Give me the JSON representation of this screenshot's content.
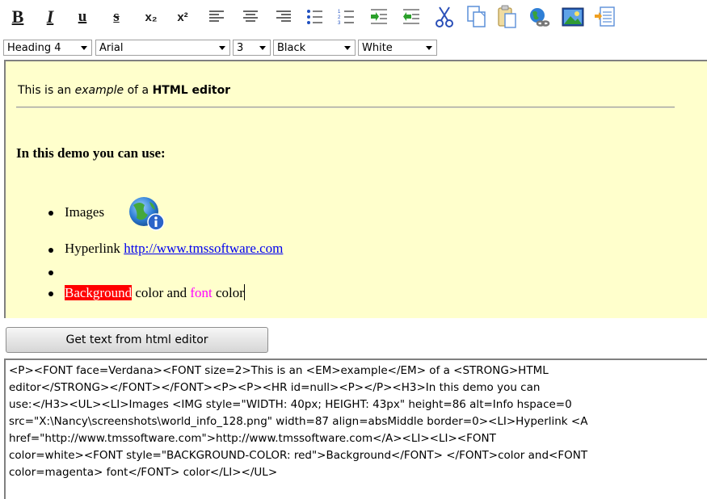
{
  "toolbar": {
    "bold": "B",
    "italic": "I",
    "underline": "u",
    "strikeout": "s",
    "subscript": "x₂",
    "superscript": "x²",
    "icons": [
      "align-left-icon",
      "align-center-icon",
      "align-right-icon",
      "bullet-list-icon",
      "numbered-list-icon",
      "indent-icon",
      "outdent-icon",
      "cut-icon",
      "copy-icon",
      "paste-icon",
      "hyperlink-icon",
      "insert-image-icon",
      "insert-text-icon"
    ]
  },
  "format": {
    "heading": "Heading 4",
    "font": "Arial",
    "size": "3",
    "font_color": "Black",
    "bg_color": "White"
  },
  "editor": {
    "line1": {
      "pre": "This is an ",
      "em": "example",
      "mid": " of a ",
      "strong": "HTML editor"
    },
    "heading": "In this demo you can use:",
    "items": {
      "images": "Images",
      "hyperlink_label": "Hyperlink ",
      "hyperlink_url": "http://www.tmssoftware.com",
      "bg_word": "Background",
      "color_mid": " color and ",
      "font_word": "font",
      "color_end": " color"
    },
    "image_icon": "world-info-icon",
    "colors": {
      "background": "#ffffcc",
      "highlight_bg": "#ff0000",
      "font_color": "#ff00ff",
      "link": "#0000ee"
    }
  },
  "button": {
    "label": "Get text from html editor"
  },
  "output": {
    "lines": [
      "<P><FONT face=Verdana><FONT size=2>This is an <EM>example</EM> of a <STRONG>HTML",
      "editor</STRONG></FONT></FONT><P><P><HR id=null><P></P><H3>In this demo you can",
      "use:</H3><UL><LI>Images <IMG style=\"WIDTH: 40px; HEIGHT: 43px\" height=86 alt=Info hspace=0",
      "src=\"X:\\Nancy\\screenshots\\world_info_128.png\" width=87 align=absMiddle border=0><LI>Hyperlink <A",
      "href=\"http://www.tmssoftware.com\">http://www.tmssoftware.com</A><LI><LI><FONT",
      "color=white><FONT style=\"BACKGROUND-COLOR: red\">Background</FONT> </FONT>color and<FONT",
      "color=magenta> font</FONT> color</LI></UL>"
    ]
  }
}
